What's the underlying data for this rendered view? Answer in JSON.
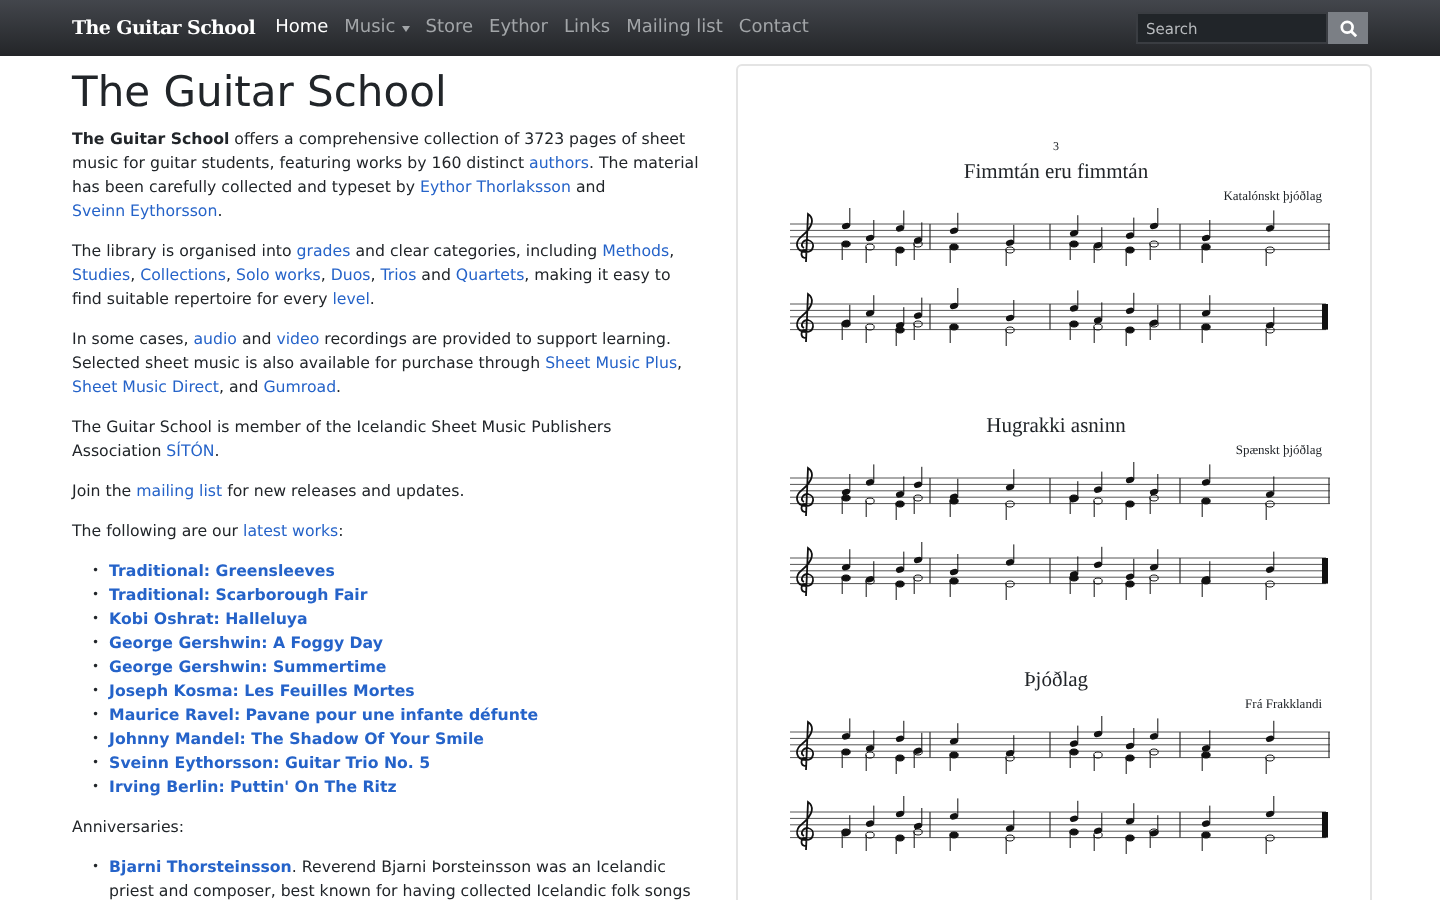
{
  "navbar": {
    "brand": "The Guitar School",
    "items": [
      {
        "label": "Home",
        "selected": true,
        "dropdown": false
      },
      {
        "label": "Music",
        "selected": false,
        "dropdown": true
      },
      {
        "label": "Store",
        "selected": false,
        "dropdown": false
      },
      {
        "label": "Eythor",
        "selected": false,
        "dropdown": false
      },
      {
        "label": "Links",
        "selected": false,
        "dropdown": false
      },
      {
        "label": "Mailing list",
        "selected": false,
        "dropdown": false
      },
      {
        "label": "Contact",
        "selected": false,
        "dropdown": false
      }
    ],
    "search": {
      "placeholder": "Search"
    }
  },
  "heading": "The Guitar School",
  "paragraphs": [
    [
      {
        "kind": "bold",
        "text": "The Guitar School"
      },
      {
        "kind": "text",
        "text": " offers a comprehensive collection of 3723 pages of sheet music for guitar students, featuring works by 160 distinct "
      },
      {
        "kind": "link",
        "text": "authors"
      },
      {
        "kind": "text",
        "text": ". The material has been carefully collected and typeset by "
      },
      {
        "kind": "link",
        "text": "Eythor Thorlaksson"
      },
      {
        "kind": "text",
        "text": " and "
      },
      {
        "kind": "link",
        "text": "Sveinn Eythorsson"
      },
      {
        "kind": "text",
        "text": "."
      }
    ],
    [
      {
        "kind": "text",
        "text": "The library is organised into "
      },
      {
        "kind": "link",
        "text": "grades"
      },
      {
        "kind": "text",
        "text": " and clear categories, including "
      },
      {
        "kind": "link",
        "text": "Methods"
      },
      {
        "kind": "text",
        "text": ", "
      },
      {
        "kind": "link",
        "text": "Studies"
      },
      {
        "kind": "text",
        "text": ", "
      },
      {
        "kind": "link",
        "text": "Collections"
      },
      {
        "kind": "text",
        "text": ", "
      },
      {
        "kind": "link",
        "text": "Solo works"
      },
      {
        "kind": "text",
        "text": ", "
      },
      {
        "kind": "link",
        "text": "Duos"
      },
      {
        "kind": "text",
        "text": ", "
      },
      {
        "kind": "link",
        "text": "Trios"
      },
      {
        "kind": "text",
        "text": " and "
      },
      {
        "kind": "link",
        "text": "Quartets"
      },
      {
        "kind": "text",
        "text": ", making it easy to find suitable repertoire for every "
      },
      {
        "kind": "link",
        "text": "level"
      },
      {
        "kind": "text",
        "text": "."
      }
    ],
    [
      {
        "kind": "text",
        "text": "In some cases, "
      },
      {
        "kind": "link",
        "text": "audio"
      },
      {
        "kind": "text",
        "text": " and "
      },
      {
        "kind": "link",
        "text": "video"
      },
      {
        "kind": "text",
        "text": " recordings are provided to support learning. Selected sheet music is also available for purchase through "
      },
      {
        "kind": "link",
        "text": "Sheet Music Plus"
      },
      {
        "kind": "text",
        "text": ", "
      },
      {
        "kind": "link",
        "text": "Sheet Music Direct"
      },
      {
        "kind": "text",
        "text": ", and "
      },
      {
        "kind": "link",
        "text": "Gumroad"
      },
      {
        "kind": "text",
        "text": "."
      }
    ],
    [
      {
        "kind": "text",
        "text": "The Guitar School is member of the Icelandic Sheet Music Publishers Association "
      },
      {
        "kind": "link",
        "text": "SÍTÓN"
      },
      {
        "kind": "text",
        "text": "."
      }
    ],
    [
      {
        "kind": "text",
        "text": "Join the "
      },
      {
        "kind": "link",
        "text": "mailing list"
      },
      {
        "kind": "text",
        "text": " for new releases and updates."
      }
    ],
    [
      {
        "kind": "text",
        "text": "The following are our "
      },
      {
        "kind": "link",
        "text": "latest works"
      },
      {
        "kind": "text",
        "text": ":"
      }
    ]
  ],
  "latest_works": [
    "Traditional: Greensleeves",
    "Traditional: Scarborough Fair",
    "Kobi Oshrat: Halleluya",
    "George Gershwin: A Foggy Day",
    "George Gershwin: Summertime",
    "Joseph Kosma: Les Feuilles Mortes",
    "Maurice Ravel: Pavane pour une infante défunte",
    "Johnny Mandel: The Shadow Of Your Smile",
    "Sveinn Eythorsson: Guitar Trio No. 5",
    "Irving Berlin: Puttin' On The Ritz"
  ],
  "bullet": "•",
  "anniversaries_label": "Anniversaries:",
  "anniversaries": [
    {
      "name": "Bjarni Thorsteinsson",
      "text": ". Reverend Bjarni Þorsteinsson was an Icelandic priest and composer, best known for having collected Icelandic folk songs"
    }
  ],
  "sheet": {
    "page_number": "3",
    "pieces": [
      {
        "title": "Fimmtán eru fimmtán",
        "origin": "Katalónskt þjóðlag"
      },
      {
        "title": "Hugrakki asninn",
        "origin": "Spænskt þjóðlag"
      },
      {
        "title": "Þjóðlag",
        "origin": "Frá Frakklandi"
      }
    ]
  }
}
